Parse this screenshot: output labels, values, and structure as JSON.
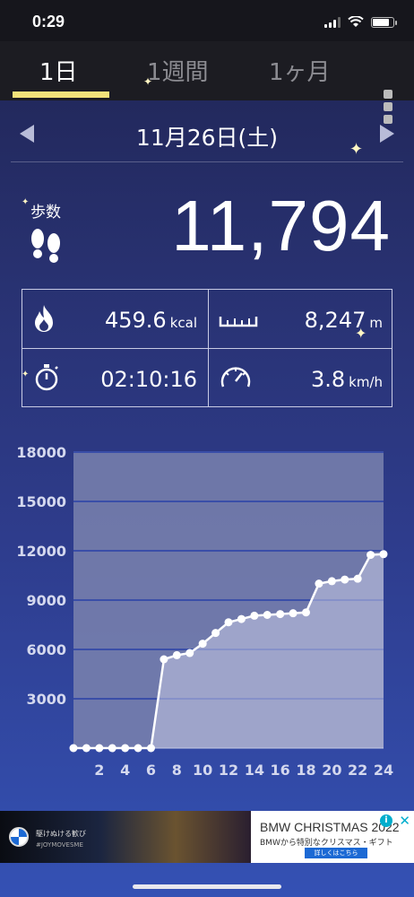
{
  "status": {
    "time": "0:29"
  },
  "tabs": [
    {
      "label": "1日",
      "active": true
    },
    {
      "label": "1週間",
      "active": false
    },
    {
      "label": "1ヶ月",
      "active": false
    }
  ],
  "date": {
    "label": "11月26日(土)"
  },
  "steps": {
    "label": "歩数",
    "value": "11,794"
  },
  "stats": {
    "calories": {
      "value": "459.6",
      "unit": "kcal"
    },
    "distance": {
      "value": "8,247",
      "unit": "m"
    },
    "duration": {
      "value": "02:10:16",
      "unit": ""
    },
    "speed": {
      "value": "3.8",
      "unit": "km/h"
    }
  },
  "icons": {
    "calories": "flame-icon",
    "distance": "ruler-icon",
    "duration": "stopwatch-icon",
    "speed": "speedometer-icon",
    "steps": "footprints-icon"
  },
  "colors": {
    "tab_indicator": "#f2e27a",
    "chart_line": "#ffffff",
    "ad_accent": "#1c69d4"
  },
  "chart_data": {
    "type": "line",
    "x": [
      0,
      1,
      2,
      3,
      4,
      5,
      6,
      7,
      8,
      9,
      10,
      11,
      12,
      13,
      14,
      15,
      16,
      17,
      18,
      19,
      20,
      21,
      22,
      23,
      24
    ],
    "series": [
      {
        "values": [
          0,
          0,
          0,
          0,
          0,
          0,
          0,
          5400,
          5650,
          5780,
          6350,
          7000,
          7650,
          7850,
          8050,
          8100,
          8150,
          8200,
          8250,
          10000,
          10150,
          10250,
          10300,
          11750,
          11794
        ]
      }
    ],
    "x_ticks": [
      "2",
      "4",
      "6",
      "8",
      "10",
      "12",
      "14",
      "16",
      "18",
      "20",
      "22",
      "24"
    ],
    "y_ticks": [
      "3000",
      "6000",
      "9000",
      "12000",
      "15000",
      "18000"
    ],
    "ylim": [
      0,
      18000
    ],
    "xlim": [
      0,
      24
    ],
    "grid": true,
    "fill": true
  },
  "ad": {
    "left_line1": "駆けぬける歓び",
    "left_line2": "#JOYMOVESME",
    "title": "BMW CHRISTMAS 2022",
    "subtitle": "BMWから特別なクリスマス・ギフト",
    "cta": "詳しくはこちら",
    "info": "i",
    "close": "✕"
  }
}
